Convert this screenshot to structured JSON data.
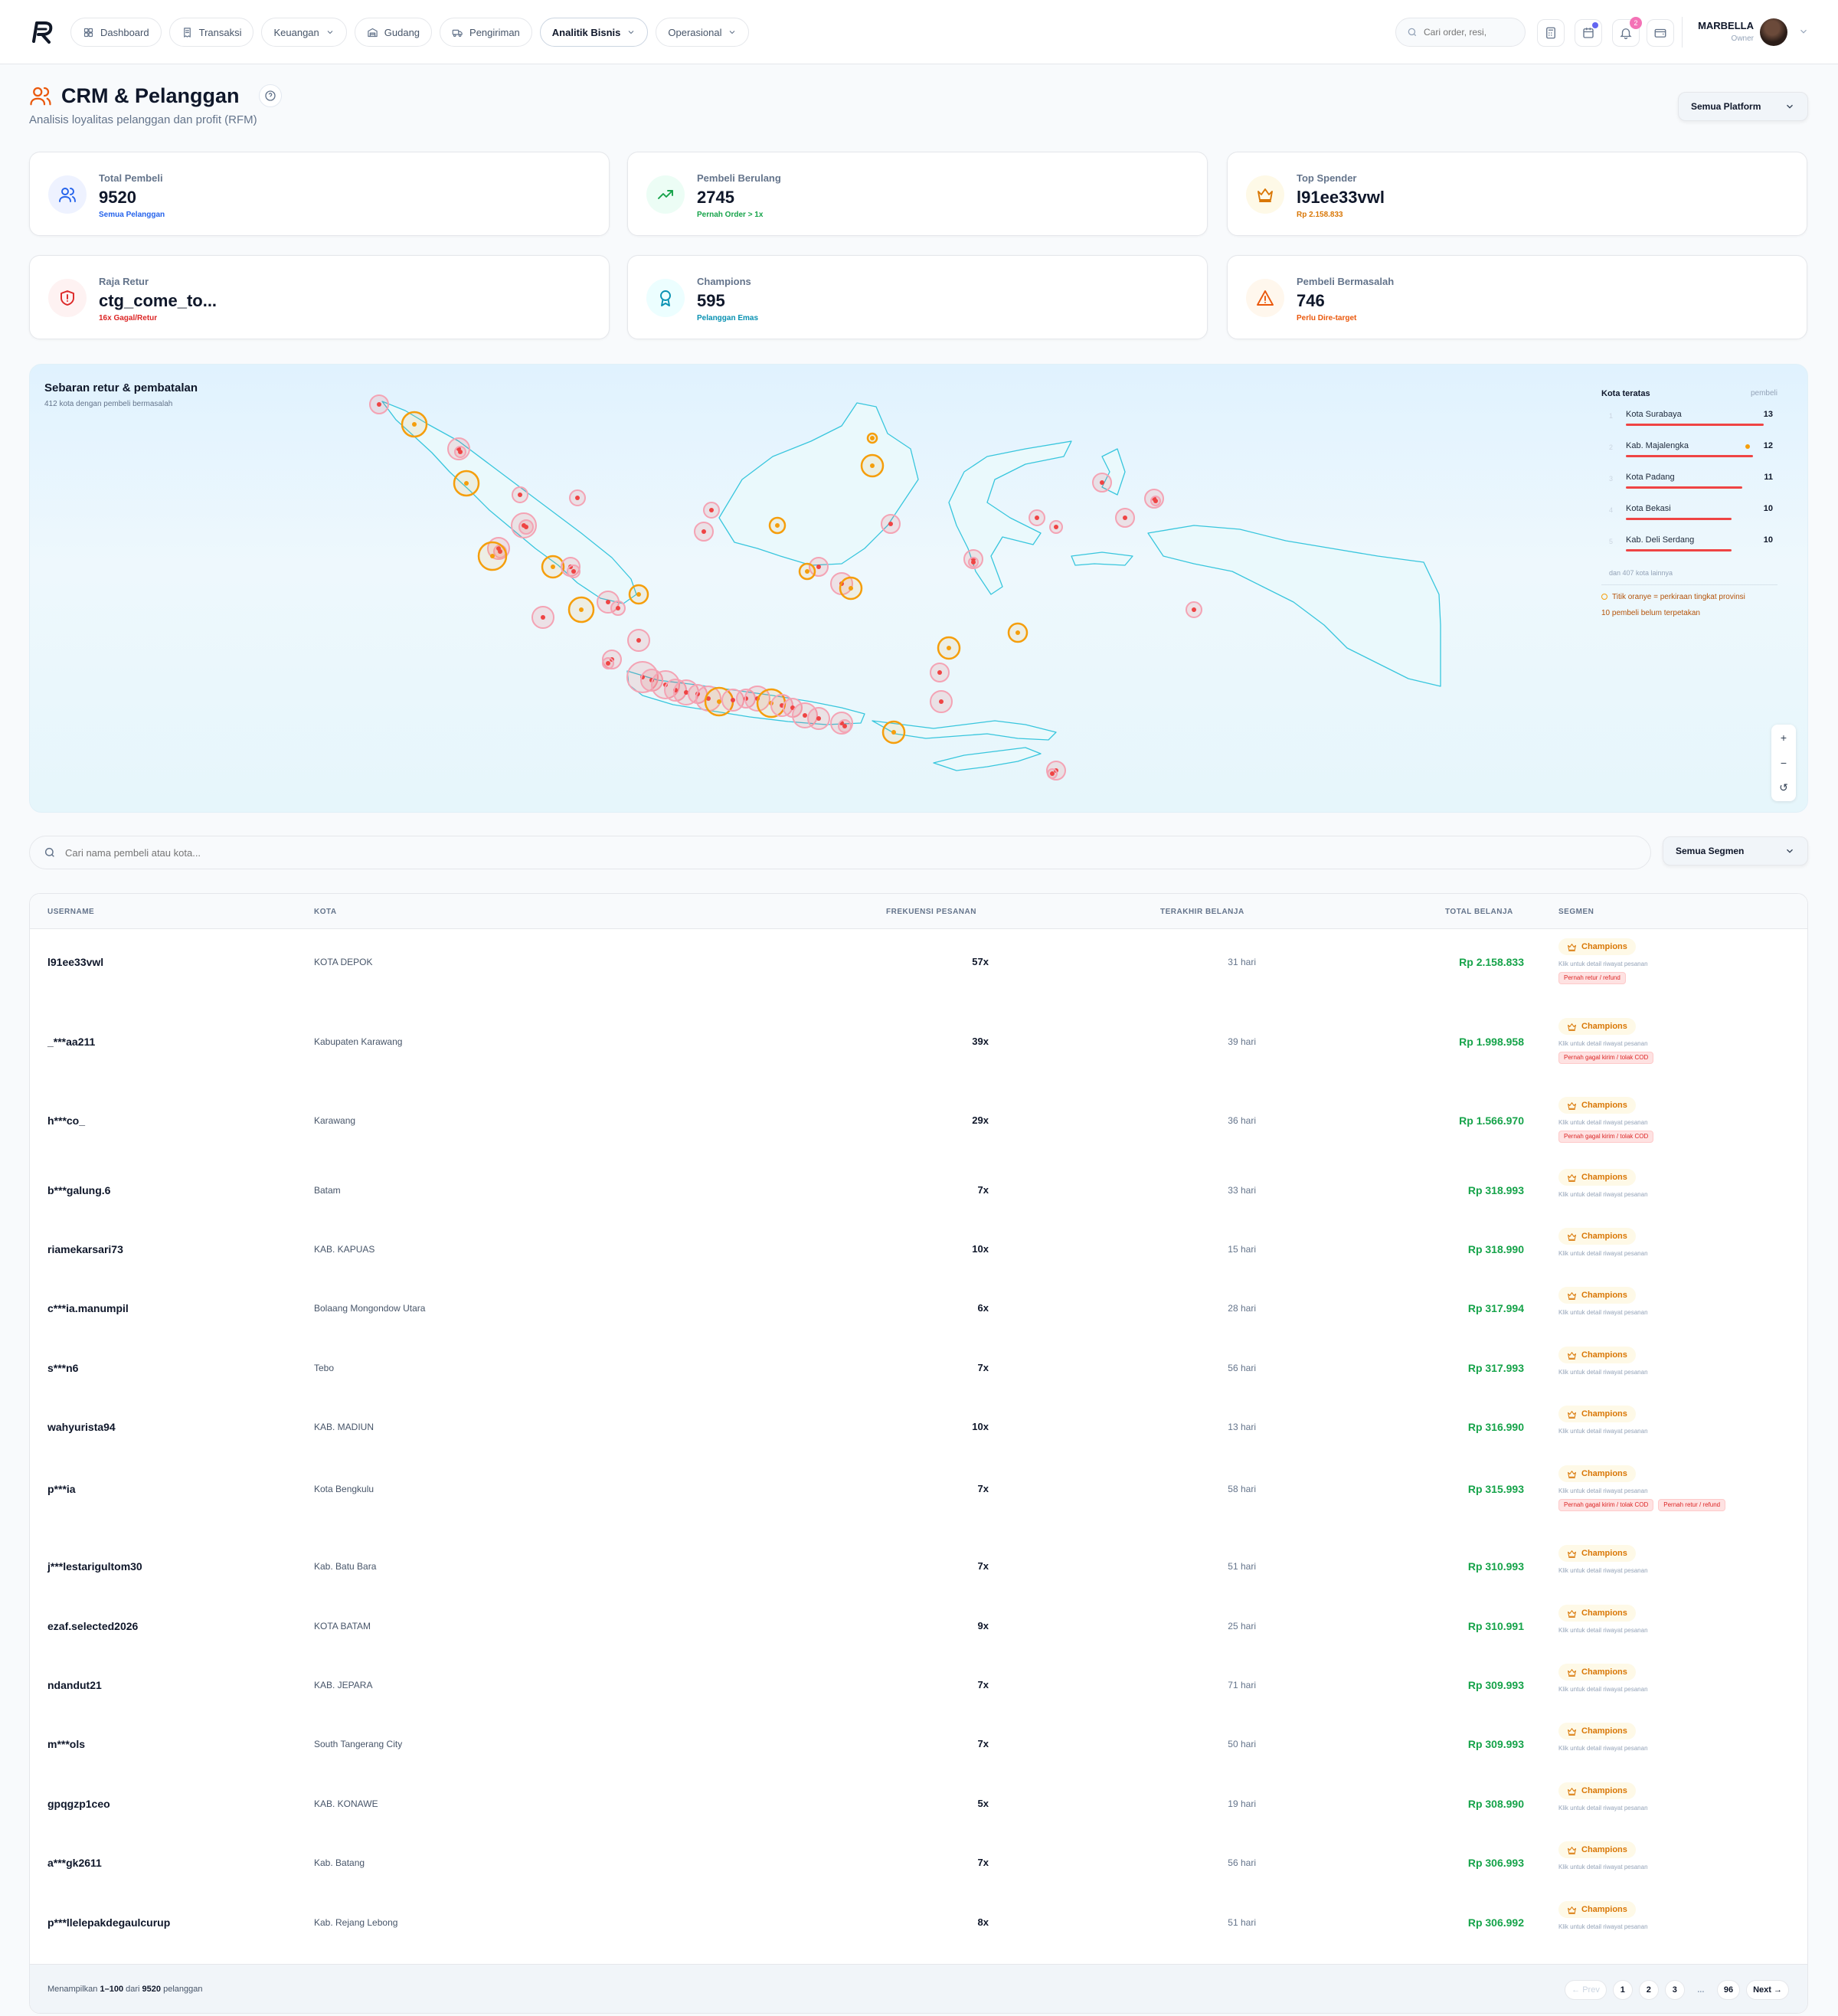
{
  "nav": {
    "items": [
      {
        "label": "Dashboard",
        "icon": "grid-icon",
        "chevron": false,
        "active": false
      },
      {
        "label": "Transaksi",
        "icon": "receipt-icon",
        "chevron": false,
        "active": false
      },
      {
        "label": "Keuangan",
        "icon": "",
        "chevron": true,
        "active": false
      },
      {
        "label": "Gudang",
        "icon": "warehouse-icon",
        "chevron": false,
        "active": false
      },
      {
        "label": "Pengiriman",
        "icon": "truck-icon",
        "chevron": false,
        "active": false
      },
      {
        "label": "Analitik Bisnis",
        "icon": "",
        "chevron": true,
        "active": true
      },
      {
        "label": "Operasional",
        "icon": "",
        "chevron": true,
        "active": false
      }
    ],
    "search_placeholder": "Cari order, resi,",
    "notification_count": "2",
    "user_name": "MARBELLA",
    "user_role": "Owner"
  },
  "header": {
    "title": "CRM & Pelanggan",
    "subtitle": "Analisis loyalitas pelanggan dan profit (RFM)",
    "platform_select": "Semua Platform"
  },
  "stats": [
    {
      "label": "Total Pembeli",
      "value": "9520",
      "note": "Semua Pelanggan",
      "color": "#2563eb",
      "bg": "#eef2ff",
      "icon": "users-icon"
    },
    {
      "label": "Pembeli Berulang",
      "value": "2745",
      "note": "Pernah Order > 1x",
      "color": "#16a34a",
      "bg": "#ecfdf5",
      "icon": "trending-up-icon"
    },
    {
      "label": "Top Spender",
      "value": "l91ee33vwl",
      "note": "Rp 2.158.833",
      "color": "#d97706",
      "bg": "#fef9e7",
      "icon": "crown-icon"
    },
    {
      "label": "Raja Retur",
      "value": "ctg_come_to...",
      "note": "16x Gagal/Retur",
      "color": "#dc2626",
      "bg": "#fef2f2",
      "icon": "shield-alert-icon"
    },
    {
      "label": "Champions",
      "value": "595",
      "note": "Pelanggan Emas",
      "color": "#0891b2",
      "bg": "#ecfeff",
      "icon": "award-icon"
    },
    {
      "label": "Pembeli Bermasalah",
      "value": "746",
      "note": "Perlu Dire-target",
      "color": "#ea580c",
      "bg": "#fff7ed",
      "icon": "warning-icon"
    }
  ],
  "map": {
    "title": "Sebaran retur & pembatalan",
    "subtitle": "412 kota dengan pembeli bermasalah",
    "legend_title": "Kota teratas",
    "legend_unit": "pembeli",
    "top_cities": [
      {
        "rank": "1",
        "name": "Kota Surabaya",
        "count": 13,
        "approx": false
      },
      {
        "rank": "2",
        "name": "Kab. Majalengka",
        "count": 12,
        "approx": true
      },
      {
        "rank": "3",
        "name": "Kota Padang",
        "count": 11,
        "approx": false
      },
      {
        "rank": "4",
        "name": "Kota Bekasi",
        "count": 10,
        "approx": false
      },
      {
        "rank": "5",
        "name": "Kab. Deli Serdang",
        "count": 10,
        "approx": false
      }
    ],
    "more_text": "dan 407 kota lainnya",
    "approx_note": "Titik oranye = perkiraan tingkat provinsi",
    "unmapped_note": "10 pembeli belum terpetakan",
    "zoom_in": "+",
    "zoom_out": "−",
    "reset": "↺"
  },
  "filters": {
    "search_placeholder": "Cari nama pembeli atau kota...",
    "segment_select": "Semua Segmen"
  },
  "table": {
    "columns": [
      "USERNAME",
      "KOTA",
      "FREKUENSI PESANAN",
      "TERAKHIR BELANJA",
      "TOTAL BELANJA",
      "SEGMEN"
    ],
    "segment_hint": "Klik untuk detail riwayat pesanan",
    "rows": [
      {
        "username": "l91ee33vwl",
        "city": "KOTA DEPOK",
        "freq": "57x",
        "last": "31 hari",
        "total": "Rp 2.158.833",
        "segment": "Champions",
        "tags": [
          "Pernah retur / refund"
        ]
      },
      {
        "username": "_***aa211",
        "city": "Kabupaten Karawang",
        "freq": "39x",
        "last": "39 hari",
        "total": "Rp 1.998.958",
        "segment": "Champions",
        "tags": [
          "Pernah gagal kirim / tolak COD"
        ]
      },
      {
        "username": "h***co_",
        "city": "Karawang",
        "freq": "29x",
        "last": "36 hari",
        "total": "Rp 1.566.970",
        "segment": "Champions",
        "tags": [
          "Pernah gagal kirim / tolak COD"
        ]
      },
      {
        "username": "b***galung.6",
        "city": "Batam",
        "freq": "7x",
        "last": "33 hari",
        "total": "Rp 318.993",
        "segment": "Champions",
        "tags": []
      },
      {
        "username": "riamekarsari73",
        "city": "KAB. KAPUAS",
        "freq": "10x",
        "last": "15 hari",
        "total": "Rp 318.990",
        "segment": "Champions",
        "tags": []
      },
      {
        "username": "c***ia.manumpil",
        "city": "Bolaang Mongondow Utara",
        "freq": "6x",
        "last": "28 hari",
        "total": "Rp 317.994",
        "segment": "Champions",
        "tags": []
      },
      {
        "username": "s***n6",
        "city": "Tebo",
        "freq": "7x",
        "last": "56 hari",
        "total": "Rp 317.993",
        "segment": "Champions",
        "tags": []
      },
      {
        "username": "wahyurista94",
        "city": "KAB. MADIUN",
        "freq": "10x",
        "last": "13 hari",
        "total": "Rp 316.990",
        "segment": "Champions",
        "tags": []
      },
      {
        "username": "p***ia",
        "city": "Kota Bengkulu",
        "freq": "7x",
        "last": "58 hari",
        "total": "Rp 315.993",
        "segment": "Champions",
        "tags": [
          "Pernah gagal kirim / tolak COD",
          "Pernah retur / refund"
        ]
      },
      {
        "username": "j***lestarigultom30",
        "city": "Kab. Batu Bara",
        "freq": "7x",
        "last": "51 hari",
        "total": "Rp 310.993",
        "segment": "Champions",
        "tags": []
      },
      {
        "username": "ezaf.selected2026",
        "city": "KOTA BATAM",
        "freq": "9x",
        "last": "25 hari",
        "total": "Rp 310.991",
        "segment": "Champions",
        "tags": []
      },
      {
        "username": "ndandut21",
        "city": "KAB. JEPARA",
        "freq": "7x",
        "last": "71 hari",
        "total": "Rp 309.993",
        "segment": "Champions",
        "tags": []
      },
      {
        "username": "m***ols",
        "city": "South Tangerang City",
        "freq": "7x",
        "last": "50 hari",
        "total": "Rp 309.993",
        "segment": "Champions",
        "tags": []
      },
      {
        "username": "gpqgzp1ceo",
        "city": "KAB. KONAWE",
        "freq": "5x",
        "last": "19 hari",
        "total": "Rp 308.990",
        "segment": "Champions",
        "tags": []
      },
      {
        "username": "a***gk2611",
        "city": "Kab. Batang",
        "freq": "7x",
        "last": "56 hari",
        "total": "Rp 306.993",
        "segment": "Champions",
        "tags": []
      },
      {
        "username": "p***llelepakdegaulcurup",
        "city": "Kab. Rejang Lebong",
        "freq": "8x",
        "last": "51 hari",
        "total": "Rp 306.992",
        "segment": "Champions",
        "tags": []
      }
    ],
    "footer": {
      "prefix": "Menampilkan",
      "range": "1–100",
      "mid": "dari",
      "total": "9520",
      "suffix": "pelanggan"
    },
    "pager": [
      "← Prev",
      "1",
      "2",
      "3",
      "...",
      "96",
      "Next →"
    ]
  }
}
